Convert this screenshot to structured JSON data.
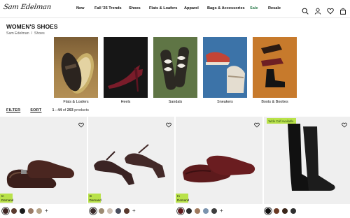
{
  "header": {
    "logo": "Sam Edelman",
    "nav": [
      "New",
      "Fall '25 Trends",
      "Shoes",
      "Flats & Loafers",
      "Apparel",
      "Bags & Accessories",
      "Sale",
      "Resale"
    ]
  },
  "icons": [
    "search-icon",
    "account-icon",
    "wishlist-icon",
    "bag-icon"
  ],
  "page": {
    "title": "WOMEN'S SHOES",
    "breadcrumb": [
      "Sam Edelman",
      "/",
      "Shoes"
    ]
  },
  "categories": [
    {
      "label": "Flats & Loafers"
    },
    {
      "label": "Heels"
    },
    {
      "label": "Sandals"
    },
    {
      "label": "Sneakers"
    },
    {
      "label": "Boots & Booties"
    }
  ],
  "toolbar": {
    "filter": "FILTER",
    "sort": "SORT",
    "range": "1 - 44",
    "of": "of",
    "total": "293",
    "products": "products"
  },
  "products": [
    {
      "demand": "In Demand",
      "swatches": [
        "#3b2320",
        "#5a3a2e",
        "#1a1a1a",
        "#9a7b66",
        "#b7a489"
      ],
      "plus": "+"
    },
    {
      "demand": "In Demand",
      "swatches": [
        "#3a2b2b",
        "#9c8b73",
        "#cdbfb3",
        "#4a4e5d",
        "#5a3a2e"
      ],
      "plus": "+"
    },
    {
      "demand": "In Demand",
      "swatches": [
        "#5d1a1c",
        "#2d2d2d",
        "#9f7a5e",
        "#7b93ad",
        "#3e3e3e"
      ],
      "plus": "+"
    },
    {
      "callout": "Wide Calf Available",
      "swatches": [
        "#111111",
        "#6a3a24",
        "#3a2519",
        "#2f2f2f"
      ]
    }
  ],
  "colors": {
    "sale": "#2f7d4f",
    "demand_badge": "#b9e24a"
  }
}
